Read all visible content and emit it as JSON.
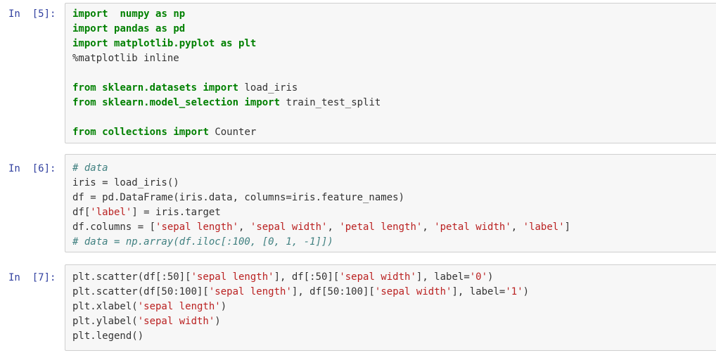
{
  "cells": [
    {
      "prompt": "In  [5]:",
      "lines": [
        [
          [
            "kw",
            "import"
          ],
          [
            "",
            "  "
          ],
          [
            "kw",
            "numpy"
          ],
          [
            "",
            " "
          ],
          [
            "kw",
            "as"
          ],
          [
            "",
            " "
          ],
          [
            "kw",
            "np"
          ]
        ],
        [
          [
            "kw",
            "import"
          ],
          [
            "",
            " "
          ],
          [
            "kw",
            "pandas"
          ],
          [
            "",
            " "
          ],
          [
            "kw",
            "as"
          ],
          [
            "",
            " "
          ],
          [
            "kw",
            "pd"
          ]
        ],
        [
          [
            "kw",
            "import"
          ],
          [
            "",
            " "
          ],
          [
            "kw",
            "matplotlib.pyplot"
          ],
          [
            "",
            " "
          ],
          [
            "kw",
            "as"
          ],
          [
            "",
            " "
          ],
          [
            "kw",
            "plt"
          ]
        ],
        [
          [
            "",
            "%matplotlib inline"
          ]
        ],
        [],
        [
          [
            "kw",
            "from"
          ],
          [
            "",
            " "
          ],
          [
            "kw",
            "sklearn.datasets"
          ],
          [
            "",
            " "
          ],
          [
            "kw",
            "import"
          ],
          [
            "",
            " load_iris"
          ]
        ],
        [
          [
            "kw",
            "from"
          ],
          [
            "",
            " "
          ],
          [
            "kw",
            "sklearn.model_selection"
          ],
          [
            "",
            " "
          ],
          [
            "kw",
            "import"
          ],
          [
            "",
            " train_test_split"
          ]
        ],
        [],
        [
          [
            "kw",
            "from"
          ],
          [
            "",
            " "
          ],
          [
            "kw",
            "collections"
          ],
          [
            "",
            " "
          ],
          [
            "kw",
            "import"
          ],
          [
            "",
            " Counter"
          ]
        ]
      ]
    },
    {
      "prompt": "In  [6]:",
      "lines": [
        [
          [
            "cm",
            "# data"
          ]
        ],
        [
          [
            "",
            "iris = load_iris()"
          ]
        ],
        [
          [
            "",
            "df = pd.DataFrame(iris.data, columns=iris.feature_names)"
          ]
        ],
        [
          [
            "",
            "df["
          ],
          [
            "str",
            "'label'"
          ],
          [
            "",
            "] = iris.target"
          ]
        ],
        [
          [
            "",
            "df.columns = ["
          ],
          [
            "str",
            "'sepal length'"
          ],
          [
            ",",
            ""
          ],
          [
            "",
            ", "
          ],
          [
            "str",
            "'sepal width'"
          ],
          [
            "",
            ", "
          ],
          [
            "str",
            "'petal length'"
          ],
          [
            "",
            ", "
          ],
          [
            "str",
            "'petal width'"
          ],
          [
            "",
            ", "
          ],
          [
            "str",
            "'label'"
          ],
          [
            "",
            "]"
          ]
        ],
        [
          [
            "cm",
            "# data = np.array(df.iloc[:100, [0, 1, -1]])"
          ]
        ]
      ]
    },
    {
      "prompt": "In  [7]:",
      "lines": [
        [
          [
            "",
            "plt.scatter(df[:50]["
          ],
          [
            "str",
            "'sepal length'"
          ],
          [
            "",
            "], df[:50]["
          ],
          [
            "str",
            "'sepal width'"
          ],
          [
            "",
            "], label="
          ],
          [
            "str",
            "'0'"
          ],
          [
            "",
            ")"
          ]
        ],
        [
          [
            "",
            "plt.scatter(df[50:100]["
          ],
          [
            "str",
            "'sepal length'"
          ],
          [
            "",
            "], df[50:100]["
          ],
          [
            "str",
            "'sepal width'"
          ],
          [
            "",
            "], label="
          ],
          [
            "str",
            "'1'"
          ],
          [
            "",
            ")"
          ]
        ],
        [
          [
            "",
            "plt.xlabel("
          ],
          [
            "str",
            "'sepal length'"
          ],
          [
            "",
            ")"
          ]
        ],
        [
          [
            "",
            "plt.ylabel("
          ],
          [
            "str",
            "'sepal width'"
          ],
          [
            "",
            ")"
          ]
        ],
        [
          [
            "",
            "plt.legend()"
          ]
        ]
      ]
    }
  ]
}
